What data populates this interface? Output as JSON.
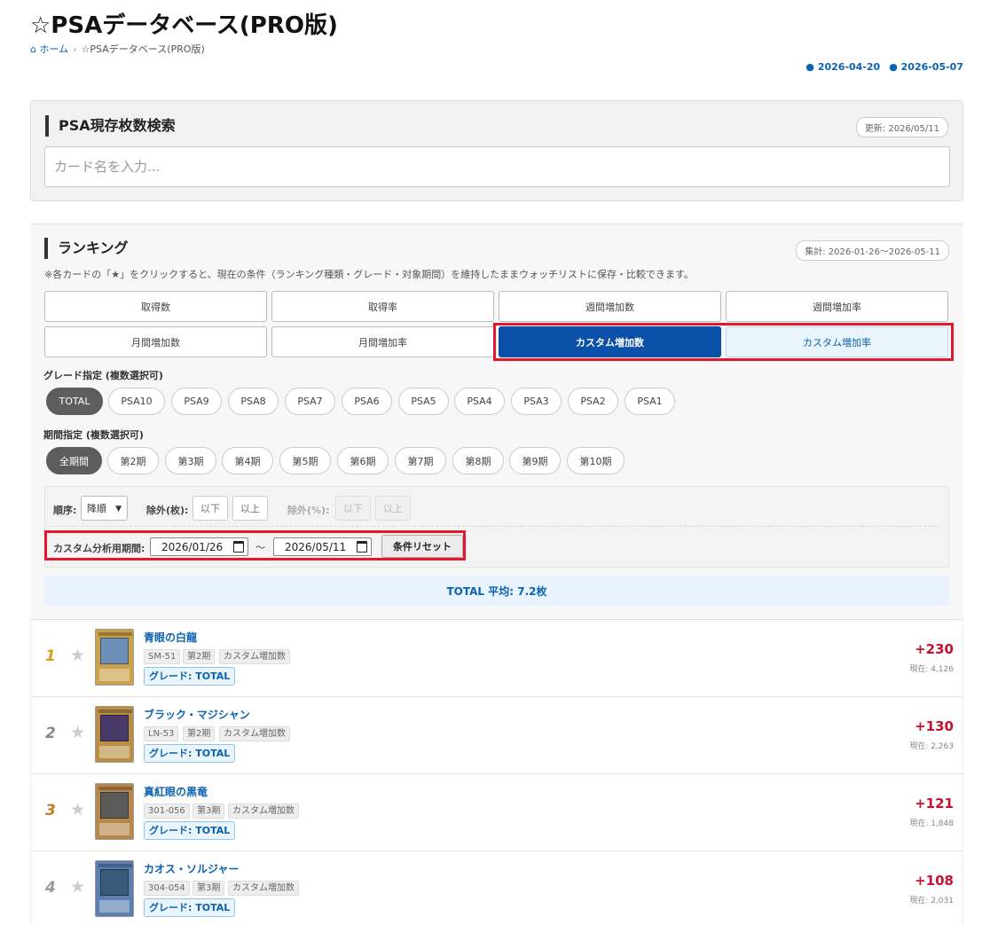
{
  "page": {
    "title": "☆PSAデータベース(PRO版)",
    "breadcrumb": {
      "home": "ホーム",
      "current": "☆PSAデータベース(PRO版)"
    },
    "dates": [
      "● 2026-04-20",
      "● 2026-05-07"
    ]
  },
  "search": {
    "heading": "PSA現存枚数検索",
    "updated": "更新: 2026/05/11",
    "placeholder": "カード名を入力..."
  },
  "ranking": {
    "heading": "ランキング",
    "period_badge": "集計: 2026-01-26〜2026-05-11",
    "note": "※各カードの「★」をクリックすると、現在の条件（ランキング種類・グレード・対象期間）を維持したままウォッチリストに保存・比較できます。",
    "tabs": [
      "取得数",
      "取得率",
      "週間増加数",
      "週間増加率",
      "月間増加数",
      "月間増加率",
      "カスタム増加数",
      "カスタム増加率"
    ],
    "active_tab": "カスタム増加数",
    "grade_label": "グレード指定 (複数選択可)",
    "grades": [
      "TOTAL",
      "PSA10",
      "PSA9",
      "PSA8",
      "PSA7",
      "PSA6",
      "PSA5",
      "PSA4",
      "PSA3",
      "PSA2",
      "PSA1"
    ],
    "period_label": "期間指定 (複数選択可)",
    "periods": [
      "全期間",
      "第2期",
      "第3期",
      "第4期",
      "第5期",
      "第6期",
      "第7期",
      "第8期",
      "第9期",
      "第10期"
    ],
    "filters": {
      "order_label": "順序:",
      "order_value": "降順",
      "exclude_count_label": "除外(枚):",
      "exclude_pct_label": "除外(%):",
      "below": "以下",
      "above": "以上",
      "custom_label": "カスタム分析用期間:",
      "date_from": "2026/01/26",
      "tilde": "～",
      "date_to": "2026/05/11",
      "reset": "条件リセット"
    },
    "average": "TOTAL 平均: 7.2枚"
  },
  "items": [
    {
      "rank": "1",
      "name": "青眼の白龍",
      "code": "SM-51",
      "period": "第2期",
      "type": "カスタム増加数",
      "grade": "グレード: TOTAL",
      "delta": "+230",
      "current": "現在: 4,126",
      "rank_color": "#d4a017",
      "card_color": "#c9a24a"
    },
    {
      "rank": "2",
      "name": "ブラック・マジシャン",
      "code": "LN-53",
      "period": "第2期",
      "type": "カスタム増加数",
      "grade": "グレード: TOTAL",
      "delta": "+130",
      "current": "現在: 2,263",
      "rank_color": "#888888",
      "card_color": "#b98f45"
    },
    {
      "rank": "3",
      "name": "真紅眼の黒竜",
      "code": "301-056",
      "period": "第3期",
      "type": "カスタム増加数",
      "grade": "グレード: TOTAL",
      "delta": "+121",
      "current": "現在: 1,848",
      "rank_color": "#c07a2b",
      "card_color": "#b8874a"
    },
    {
      "rank": "4",
      "name": "カオス・ソルジャー",
      "code": "304-054",
      "period": "第3期",
      "type": "カスタム増加数",
      "grade": "グレード: TOTAL",
      "delta": "+108",
      "current": "現在: 2,031",
      "rank_color": "#999999",
      "card_color": "#5d7fb0"
    }
  ]
}
